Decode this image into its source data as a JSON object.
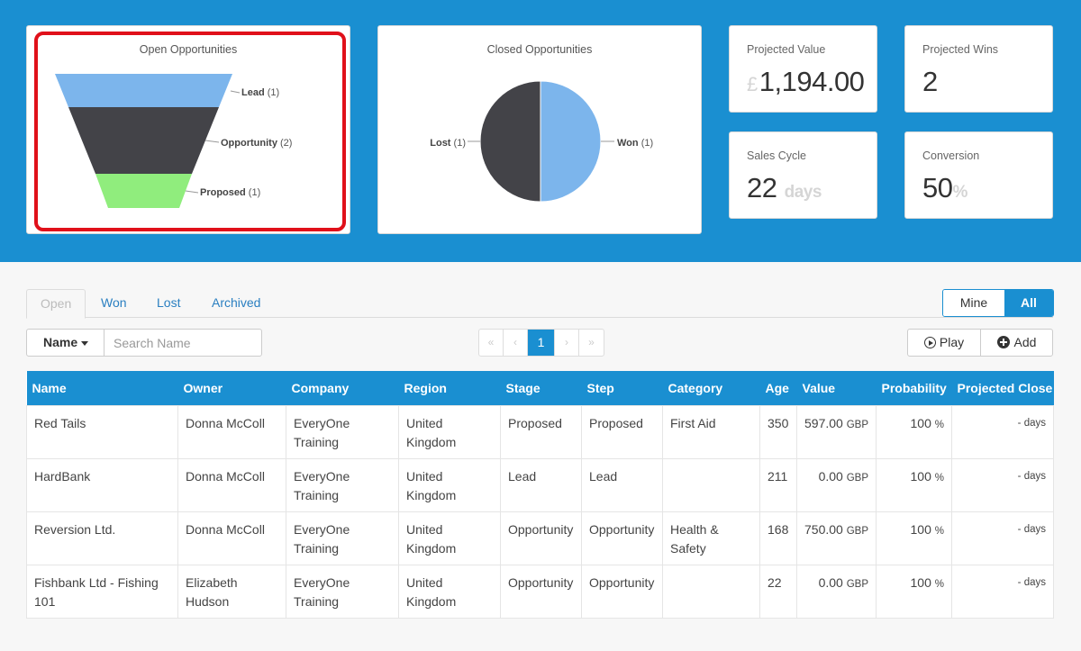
{
  "open_card": {
    "title": "Open Opportunities",
    "stages": [
      {
        "name": "Lead",
        "count": "(1)",
        "color": "#7cb5ec"
      },
      {
        "name": "Opportunity",
        "count": "(2)",
        "color": "#434348"
      },
      {
        "name": "Proposed",
        "count": "(1)",
        "color": "#90ed7d"
      }
    ]
  },
  "closed_card": {
    "title": "Closed Opportunities",
    "slices": [
      {
        "name": "Won",
        "count": "(1)",
        "value": 1,
        "color": "#7cb5ec"
      },
      {
        "name": "Lost",
        "count": "(1)",
        "value": 1,
        "color": "#434348"
      }
    ]
  },
  "stats": {
    "projected_value": {
      "label": "Projected Value",
      "currency": "£",
      "value": "1,194.00"
    },
    "projected_wins": {
      "label": "Projected Wins",
      "value": "2"
    },
    "sales_cycle": {
      "label": "Sales Cycle",
      "value": "22",
      "unit": "days"
    },
    "conversion": {
      "label": "Conversion",
      "value": "50",
      "unit": "%"
    }
  },
  "tabs": [
    "Open",
    "Won",
    "Lost",
    "Archived"
  ],
  "toggle": {
    "mine": "Mine",
    "all": "All"
  },
  "filter": {
    "name_label": "Name",
    "search_placeholder": "Search Name"
  },
  "pager": {
    "first": "«",
    "prev": "‹",
    "page": "1",
    "next": "›",
    "last": "»"
  },
  "actions": {
    "play": "Play",
    "add": "Add"
  },
  "table": {
    "headers": [
      "Name",
      "Owner",
      "Company",
      "Region",
      "Stage",
      "Step",
      "Category",
      "Age",
      "Value",
      "Probability",
      "Projected Close"
    ],
    "rows": [
      {
        "name": "Red Tails",
        "owner": "Donna McColl",
        "company": "EveryOne Training",
        "region": "United Kingdom",
        "stage": "Proposed",
        "step": "Proposed",
        "category": "First Aid",
        "age": "350",
        "value": "597.00",
        "currency": "GBP",
        "probability": "100",
        "pct": "%",
        "close": "- days"
      },
      {
        "name": "HardBank",
        "owner": "Donna McColl",
        "company": "EveryOne Training",
        "region": "United Kingdom",
        "stage": "Lead",
        "step": "Lead",
        "category": "",
        "age": "211",
        "value": "0.00",
        "currency": "GBP",
        "probability": "100",
        "pct": "%",
        "close": "- days"
      },
      {
        "name": "Reversion Ltd.",
        "owner": "Donna McColl",
        "company": "EveryOne Training",
        "region": "United Kingdom",
        "stage": "Opportunity",
        "step": "Opportunity",
        "category": "Health & Safety",
        "age": "168",
        "value": "750.00",
        "currency": "GBP",
        "probability": "100",
        "pct": "%",
        "close": "- days"
      },
      {
        "name": "Fishbank Ltd - Fishing 101",
        "owner": "Elizabeth Hudson",
        "company": "EveryOne Training",
        "region": "United Kingdom",
        "stage": "Opportunity",
        "step": "Opportunity",
        "category": "",
        "age": "22",
        "value": "0.00",
        "currency": "GBP",
        "probability": "100",
        "pct": "%",
        "close": "- days"
      }
    ]
  }
}
